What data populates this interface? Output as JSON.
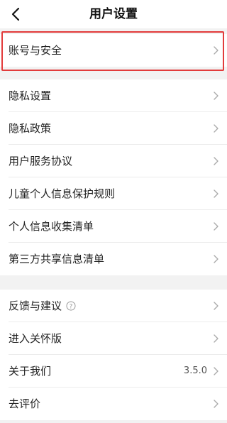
{
  "header": {
    "title": "用户设置",
    "back_icon": "chevron-left-icon"
  },
  "group1": {
    "items": [
      {
        "label": "账号与安全"
      }
    ]
  },
  "group2": {
    "items": [
      {
        "label": "隐私设置"
      },
      {
        "label": "隐私政策"
      },
      {
        "label": "用户服务协议"
      },
      {
        "label": "儿童个人信息保护规则"
      },
      {
        "label": "个人信息收集清单"
      },
      {
        "label": "第三方共享信息清单"
      }
    ]
  },
  "group3": {
    "items": [
      {
        "label": "反馈与建议",
        "icon": "help-circle-icon"
      },
      {
        "label": "进入关怀版"
      },
      {
        "label": "关于我们",
        "value": "3.5.0"
      },
      {
        "label": "去评价"
      }
    ]
  },
  "colors": {
    "highlight": "#e23b3b",
    "background": "#f2f2f2"
  }
}
